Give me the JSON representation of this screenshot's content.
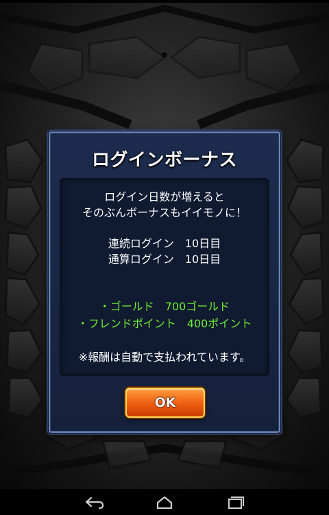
{
  "dialog": {
    "title": "ログインボーナス",
    "message_line1": "ログイン日数が増えると",
    "message_line2": "そのぶんボーナスもイイモノに！",
    "consecutive_login": "連続ログイン　10日目",
    "total_login": "通算ログイン　10日目",
    "reward_gold": "・ゴールド　700ゴールド",
    "reward_friend_points": "・フレンドポイント　400ポイント",
    "note": "※報酬は自動で支払われています。",
    "ok_label": "OK"
  },
  "navigation": {
    "back": "back-icon",
    "home": "home-icon",
    "recents": "recents-icon"
  },
  "colors": {
    "reward_text": "#6cf034",
    "dialog_background": "#1d2c4e",
    "ok_button": "#ee5c10"
  }
}
